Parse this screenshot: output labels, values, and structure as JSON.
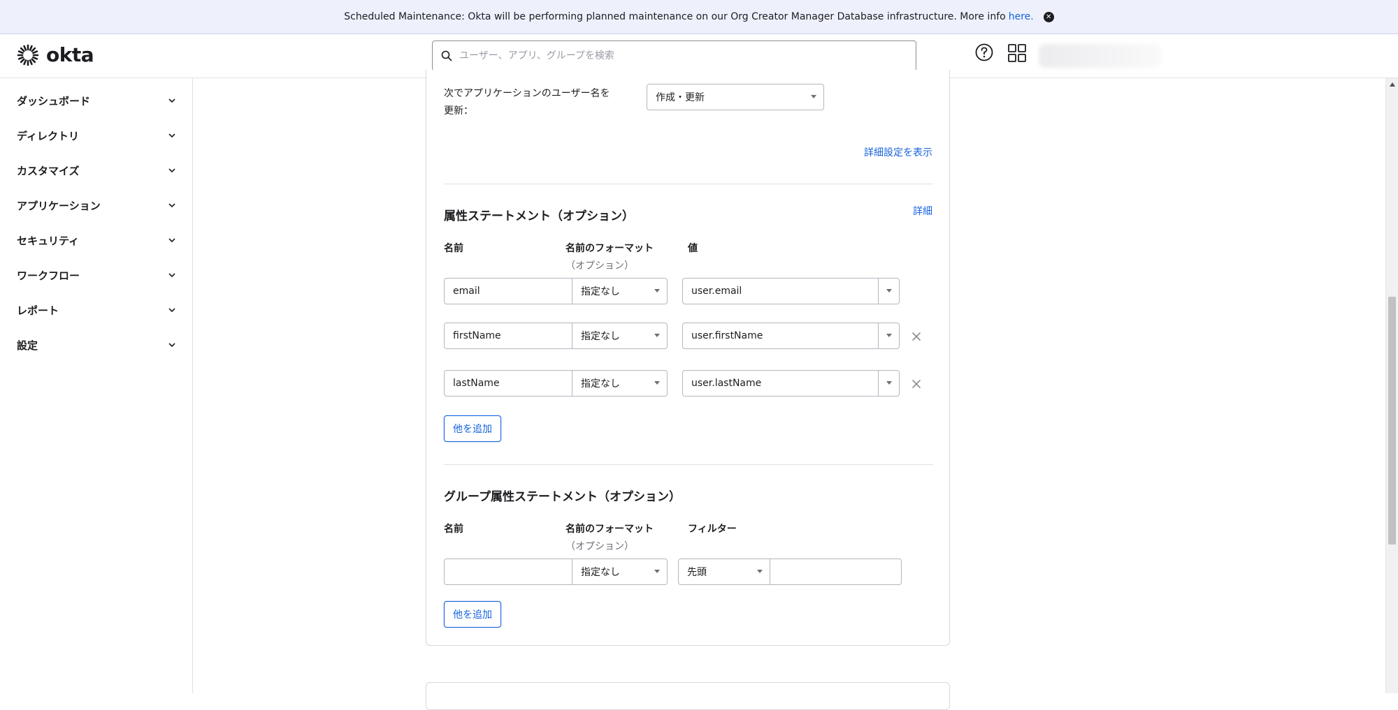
{
  "banner": {
    "message": "Scheduled Maintenance: Okta will be performing planned maintenance on our Org Creator Manager Database infrastructure. More info",
    "link_text": "here."
  },
  "header": {
    "logo_text": "okta",
    "search_placeholder": "ユーザー、アプリ、グループを検索"
  },
  "sidebar": {
    "items": [
      {
        "label": "ダッシュボード"
      },
      {
        "label": "ディレクトリ"
      },
      {
        "label": "カスタマイズ"
      },
      {
        "label": "アプリケーション"
      },
      {
        "label": "セキュリティ"
      },
      {
        "label": "ワークフロー"
      },
      {
        "label": "レポート"
      },
      {
        "label": "設定"
      }
    ]
  },
  "username_update": {
    "label_line1": "次でアプリケーションのユーザー名を",
    "label_line2": "更新：",
    "value": "作成・更新"
  },
  "advanced_link": "詳細設定を表示",
  "attribute_statements": {
    "title": "属性ステートメント（オプション）",
    "detail_link": "詳細",
    "col_name": "名前",
    "col_format": "名前のフォーマット",
    "col_format_sub": "（オプション）",
    "col_value": "値",
    "rows": [
      {
        "name": "email",
        "format": "指定なし",
        "value": "user.email"
      },
      {
        "name": "firstName",
        "format": "指定なし",
        "value": "user.firstName"
      },
      {
        "name": "lastName",
        "format": "指定なし",
        "value": "user.lastName"
      }
    ],
    "add_button": "他を追加"
  },
  "group_attribute_statements": {
    "title": "グループ属性ステートメント（オプション）",
    "col_name": "名前",
    "col_format": "名前のフォーマット",
    "col_format_sub": "（オプション）",
    "col_filter": "フィルター",
    "row": {
      "name": "",
      "format": "指定なし",
      "filter_type": "先頭",
      "filter_value": ""
    },
    "add_button": "他を追加"
  },
  "colors": {
    "accent": "#1662dd",
    "banner_bg": "#eef1fc",
    "border": "#b5b5bf"
  }
}
